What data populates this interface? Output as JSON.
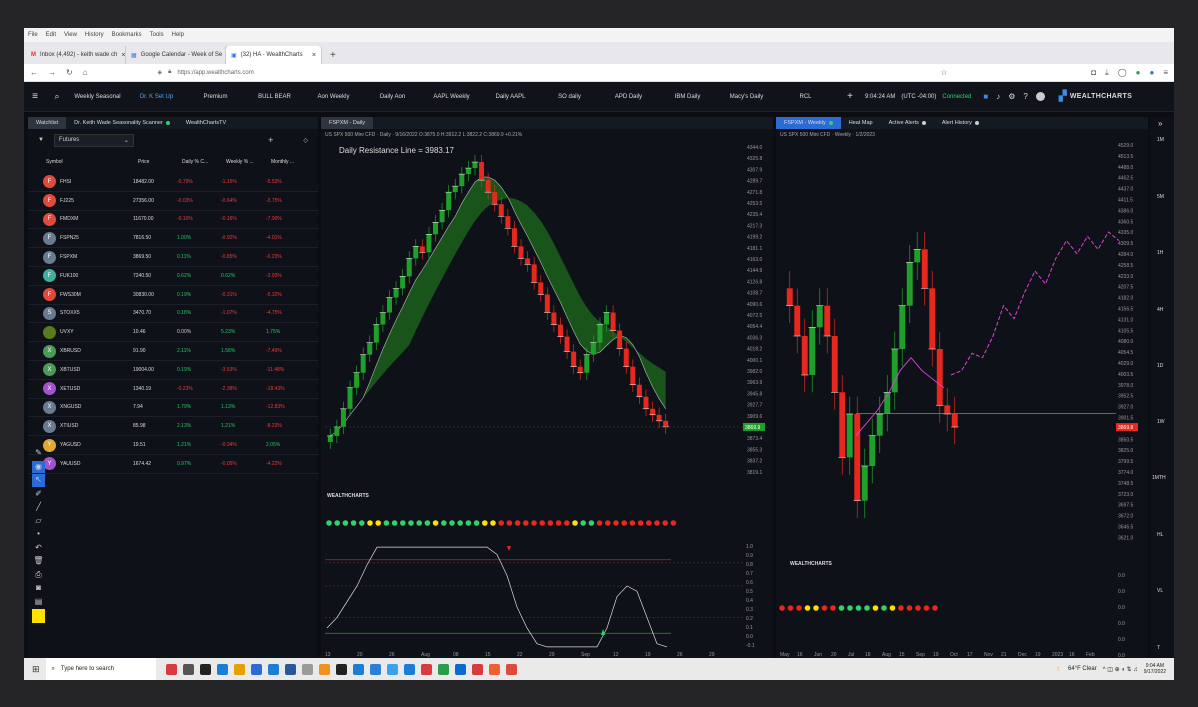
{
  "browser": {
    "menu": [
      "File",
      "Edit",
      "View",
      "History",
      "Bookmarks",
      "Tools",
      "Help"
    ],
    "tabs": [
      {
        "label": "Inbox (4,492) - keith wade ch",
        "active": false
      },
      {
        "label": "Google Calendar - Week of Se",
        "active": false
      },
      {
        "label": "(32) HA - WealthCharts",
        "active": true
      }
    ],
    "url": "https://app.wealthcharts.com"
  },
  "app": {
    "nav_tabs": [
      "Weekly Seasonal",
      "Dr. K Set Up",
      "Premium",
      "BULL BEAR",
      "Aon Weekly",
      "Daily Aon",
      "AAPL Weekly",
      "Daily AAPL",
      "SO daily",
      "APD Daily",
      "IBM Daily",
      "Macy's Daily",
      "RCL"
    ],
    "active_nav": 1,
    "time": "9:04:24 AM",
    "utc": "(UTC -04:00)",
    "connection": "Connected",
    "logo": "WEALTHCHARTS"
  },
  "watchlist_panel": {
    "tabs": [
      "Watchlist",
      "Dr. Keith Wade Seasonality Scanner",
      "WealthChartsTV"
    ],
    "dropdown": "Futures",
    "columns": [
      "Symbol",
      "Price",
      "Daily % C...",
      "Weekly % ...",
      "Monthly ..."
    ],
    "rows": [
      {
        "sym": "FHSI",
        "price": "18482.00",
        "d": "-0.79%",
        "w": "-1.15%",
        "m": "-5.53%",
        "color": "#e04a3a",
        "letter": "F"
      },
      {
        "sym": "FJ225",
        "price": "27356.00",
        "d": "-0.03%",
        "w": "-0.64%",
        "m": "-3.75%",
        "color": "#e04a3a",
        "letter": "F"
      },
      {
        "sym": "FMDXM",
        "price": "11670.00",
        "d": "-0.10%",
        "w": "-0.16%",
        "m": "-7.90%",
        "color": "#e04a3a",
        "letter": "F"
      },
      {
        "sym": "FSPN25",
        "price": "7816.50",
        "d": "1.00%",
        "w": "-0.92%",
        "m": "-4.01%",
        "color": "#6a7a90",
        "letter": "F"
      },
      {
        "sym": "FSPXM",
        "price": "3869.50",
        "d": "0.11%",
        "w": "-0.85%",
        "m": "-6.23%",
        "color": "#6a7a90",
        "letter": "F"
      },
      {
        "sym": "FUK100",
        "price": "7240.50",
        "d": "0.62%",
        "w": "0.62%",
        "m": "-3.93%",
        "color": "#3fb0a0",
        "letter": "F"
      },
      {
        "sym": "FWS30M",
        "price": "30830.00",
        "d": "0.19%",
        "w": "-0.31%",
        "m": "-5.32%",
        "color": "#e04a3a",
        "letter": "F"
      },
      {
        "sym": "STOXX5",
        "price": "3470.70",
        "d": "0.18%",
        "w": "-1.07%",
        "m": "-4.75%",
        "color": "#6a7a90",
        "letter": "S"
      },
      {
        "sym": "UVXY",
        "price": "10.46",
        "d": "0.00%",
        "w": "5.23%",
        "m": "1.75%",
        "color": "#5a7a1f",
        "letter": ""
      },
      {
        "sym": "XBRUSD",
        "price": "91.90",
        "d": "2.11%",
        "w": "1.58%",
        "m": "-7.49%",
        "color": "#4a9a58",
        "letter": "X"
      },
      {
        "sym": "XBTUSD",
        "price": "19004.00",
        "d": "0.19%",
        "w": "-3.53%",
        "m": "-11.48%",
        "color": "#4a9a58",
        "letter": "X"
      },
      {
        "sym": "XETUSD",
        "price": "1340.19",
        "d": "-0.23%",
        "w": "-2.38%",
        "m": "-18.43%",
        "color": "#a452cc",
        "letter": "X"
      },
      {
        "sym": "XNGUSD",
        "price": "7.94",
        "d": "1.79%",
        "w": "1.13%",
        "m": "-12.83%",
        "color": "#6a7a90",
        "letter": "X"
      },
      {
        "sym": "XTIUSD",
        "price": "85.98",
        "d": "2.13%",
        "w": "1.21%",
        "m": "-8.23%",
        "color": "#6a7a90",
        "letter": "X"
      },
      {
        "sym": "YAGUSD",
        "price": "19.51",
        "d": "1.21%",
        "w": "-0.34%",
        "m": "2.05%",
        "color": "#e0a830",
        "letter": "Y"
      },
      {
        "sym": "YAUUSD",
        "price": "1674.42",
        "d": "0.97%",
        "w": "-0.05%",
        "m": "-4.22%",
        "color": "#a452cc",
        "letter": "Y"
      }
    ]
  },
  "daily_chart": {
    "tab": "FSPXM - Daily",
    "info": "US SPX 500 Mini CFD  ·  Daily · 9/16/2022 O:3875.0 H:3912.2 L:3822.2 C:3869.9 +0.21%",
    "annotation": "Daily Resistance Line = 3983.17",
    "price_tag": "3869.9",
    "logo": "WEALTHCHARTS"
  },
  "weekly_chart": {
    "tabs": [
      "FSPXM - Weekly",
      "Heat Map",
      "Active Alerts",
      "Alert History"
    ],
    "info": "US SPX 500 Mini CFD  ·  Weekly · 1/2/2023",
    "price_tag": "3869.8",
    "logo": "WEALTHCHARTS"
  },
  "timeframes": [
    "1M",
    "5M",
    "1H",
    "4H",
    "1D",
    "1W",
    "1MTH",
    "HL",
    "VL",
    "T"
  ],
  "chart_data": [
    {
      "type": "candlestick",
      "title": "FSPXM - Daily",
      "x": [
        "13",
        "20",
        "26",
        "Aug",
        "08",
        "15",
        "22",
        "29",
        "Sep",
        "12",
        "19",
        "26"
      ],
      "ylim": [
        3800,
        4345
      ],
      "annotation": "Daily Resistance Line = 3983.17",
      "y_ticks": [
        "4344.0",
        "4325.8",
        "4307.9",
        "4289.7",
        "4271.8",
        "4253.5",
        "4235.4",
        "4217.3",
        "4199.2",
        "4181.1",
        "4163.0",
        "4144.9",
        "4126.8",
        "4108.7",
        "4090.6",
        "4072.5",
        "4054.4",
        "4036.3",
        "4018.2",
        "4000.1",
        "3982.0",
        "3963.9",
        "3945.8",
        "3927.7",
        "3909.6",
        "3891.5",
        "3873.4",
        "3855.3",
        "3837.2",
        "3819.1"
      ],
      "x_ticks": [
        "13",
        "20",
        "26",
        "Aug",
        "08",
        "15",
        "22",
        "29",
        "Sep",
        "12",
        "19",
        "26",
        "29"
      ],
      "last_price": 3869.9
    },
    {
      "type": "candlestick",
      "title": "FSPXM - Weekly",
      "ylim": [
        3600,
        4530
      ],
      "y_ticks": [
        "4529.0",
        "4513.5",
        "4488.0",
        "4462.5",
        "4437.0",
        "4411.5",
        "4386.0",
        "4360.5",
        "4335.0",
        "4309.5",
        "4284.0",
        "4258.5",
        "4233.0",
        "4207.5",
        "4182.0",
        "4156.5",
        "4131.0",
        "4105.5",
        "4080.0",
        "4054.5",
        "4029.0",
        "4003.5",
        "3978.0",
        "3952.5",
        "3927.0",
        "3901.5",
        "3876.0",
        "3850.5",
        "3825.0",
        "3799.5",
        "3774.0",
        "3748.5",
        "3723.0",
        "3697.5",
        "3672.0",
        "3646.5",
        "3621.0"
      ],
      "x_ticks": [
        "May",
        "16",
        "Jun",
        "20",
        "Jul",
        "18",
        "Aug",
        "15",
        "Sep",
        "19",
        "Oct",
        "17",
        "Nov",
        "21",
        "Dec",
        "19",
        "2023",
        "16",
        "Feb"
      ],
      "last_price": 3869.8
    }
  ]
}
